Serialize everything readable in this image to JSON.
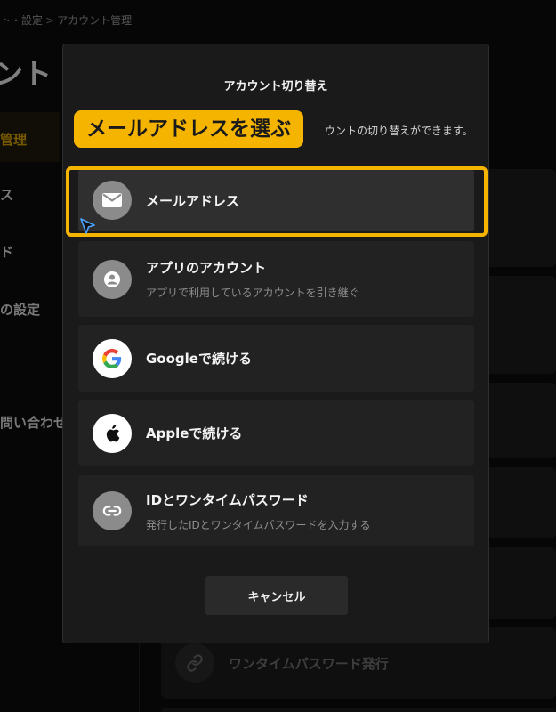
{
  "background": {
    "breadcrumb": [
      "ト・設定",
      "アカウント管理"
    ],
    "page_title": "ント・",
    "sidebar": [
      {
        "label": "管理",
        "active": true
      },
      {
        "label": "ス",
        "active": false
      },
      {
        "label": "ド",
        "active": false
      },
      {
        "label": "の設定",
        "active": false
      },
      {
        "label": "問い合わせ",
        "active": false
      }
    ],
    "last_card_label": "ワンタイムパスワード発行"
  },
  "modal": {
    "title": "アカウント切り替え",
    "description": "ウントの切り替えができます。",
    "options": [
      {
        "label": "メールアドレス",
        "sub": "",
        "icon": "mail-icon",
        "selected": true
      },
      {
        "label": "アプリのアカウント",
        "sub": "アプリで利用しているアカウントを引き継ぐ",
        "icon": "user-icon",
        "selected": false
      },
      {
        "label": "Googleで続ける",
        "sub": "",
        "icon": "google-icon",
        "selected": false
      },
      {
        "label": "Appleで続ける",
        "sub": "",
        "icon": "apple-icon",
        "selected": false
      },
      {
        "label": "IDとワンタイムパスワード",
        "sub": "発行したIDとワンタイムパスワードを入力する",
        "icon": "link-icon",
        "selected": false
      }
    ],
    "cancel_label": "キャンセル"
  },
  "annotation": {
    "callout_text": "メールアドレスを選ぶ",
    "accent_color": "#f5b400"
  }
}
